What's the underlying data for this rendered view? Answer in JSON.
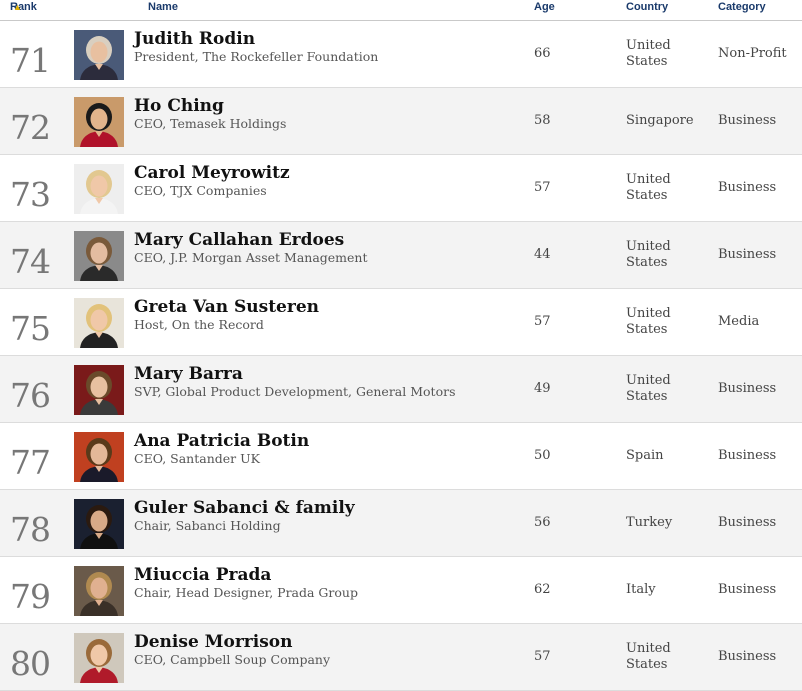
{
  "header": {
    "rank": "Rank",
    "name": "Name",
    "age": "Age",
    "country": "Country",
    "category": "Category"
  },
  "rows": [
    {
      "rank": "71",
      "name": "Judith Rodin",
      "title": "President, The Rockefeller Foundation",
      "age": "66",
      "country": "United States",
      "category": "Non-Profit",
      "photo_colors": {
        "bg": "#4a5a78",
        "skin": "#e8c0a0",
        "hair": "#d9cfc0",
        "cloth": "#2c2c3c"
      }
    },
    {
      "rank": "72",
      "name": "Ho Ching",
      "title": "CEO, Temasek Holdings",
      "age": "58",
      "country": "Singapore",
      "category": "Business",
      "photo_colors": {
        "bg": "#c99a6a",
        "skin": "#e2b48c",
        "hair": "#1a1a1a",
        "cloth": "#b0122a"
      }
    },
    {
      "rank": "73",
      "name": "Carol Meyrowitz",
      "title": "CEO, TJX Companies",
      "age": "57",
      "country": "United States",
      "category": "Business",
      "photo_colors": {
        "bg": "#eeeeee",
        "skin": "#f0c8a8",
        "hair": "#e2c890",
        "cloth": "#f4f4f4"
      }
    },
    {
      "rank": "74",
      "name": "Mary Callahan Erdoes",
      "title": "CEO, J.P. Morgan Asset Management",
      "age": "44",
      "country": "United States",
      "category": "Business",
      "photo_colors": {
        "bg": "#8a8a8a",
        "skin": "#e4bca0",
        "hair": "#7a5a3a",
        "cloth": "#2a2a2a"
      }
    },
    {
      "rank": "75",
      "name": "Greta Van Susteren",
      "title": "Host, On the Record",
      "age": "57",
      "country": "United States",
      "category": "Media",
      "photo_colors": {
        "bg": "#e8e4da",
        "skin": "#f0c8a8",
        "hair": "#e2c27a",
        "cloth": "#222222"
      }
    },
    {
      "rank": "76",
      "name": "Mary Barra",
      "title": "SVP, Global Product Development, General Motors",
      "age": "49",
      "country": "United States",
      "category": "Business",
      "photo_colors": {
        "bg": "#7a1a1a",
        "skin": "#e8c0a0",
        "hair": "#6a4a2a",
        "cloth": "#3a3a3a"
      }
    },
    {
      "rank": "77",
      "name": "Ana Patricia Botin",
      "title": "CEO, Santander UK",
      "age": "50",
      "country": "Spain",
      "category": "Business",
      "photo_colors": {
        "bg": "#c04020",
        "skin": "#e4b898",
        "hair": "#5a3a1a",
        "cloth": "#1a1a2a"
      }
    },
    {
      "rank": "78",
      "name": "Guler Sabanci & family",
      "title": "Chair, Sabanci Holding",
      "age": "56",
      "country": "Turkey",
      "category": "Business",
      "photo_colors": {
        "bg": "#1a2030",
        "skin": "#d8aa88",
        "hair": "#2a1a10",
        "cloth": "#101010"
      }
    },
    {
      "rank": "79",
      "name": "Miuccia Prada",
      "title": "Chair, Head Designer, Prada Group",
      "age": "62",
      "country": "Italy",
      "category": "Business",
      "photo_colors": {
        "bg": "#6a5a4a",
        "skin": "#e0b090",
        "hair": "#b08a50",
        "cloth": "#3a3028"
      }
    },
    {
      "rank": "80",
      "name": "Denise Morrison",
      "title": "CEO, Campbell Soup Company",
      "age": "57",
      "country": "United States",
      "category": "Business",
      "photo_colors": {
        "bg": "#cfc8bc",
        "skin": "#f0c8a8",
        "hair": "#9a6a3a",
        "cloth": "#b01a2a"
      }
    }
  ]
}
